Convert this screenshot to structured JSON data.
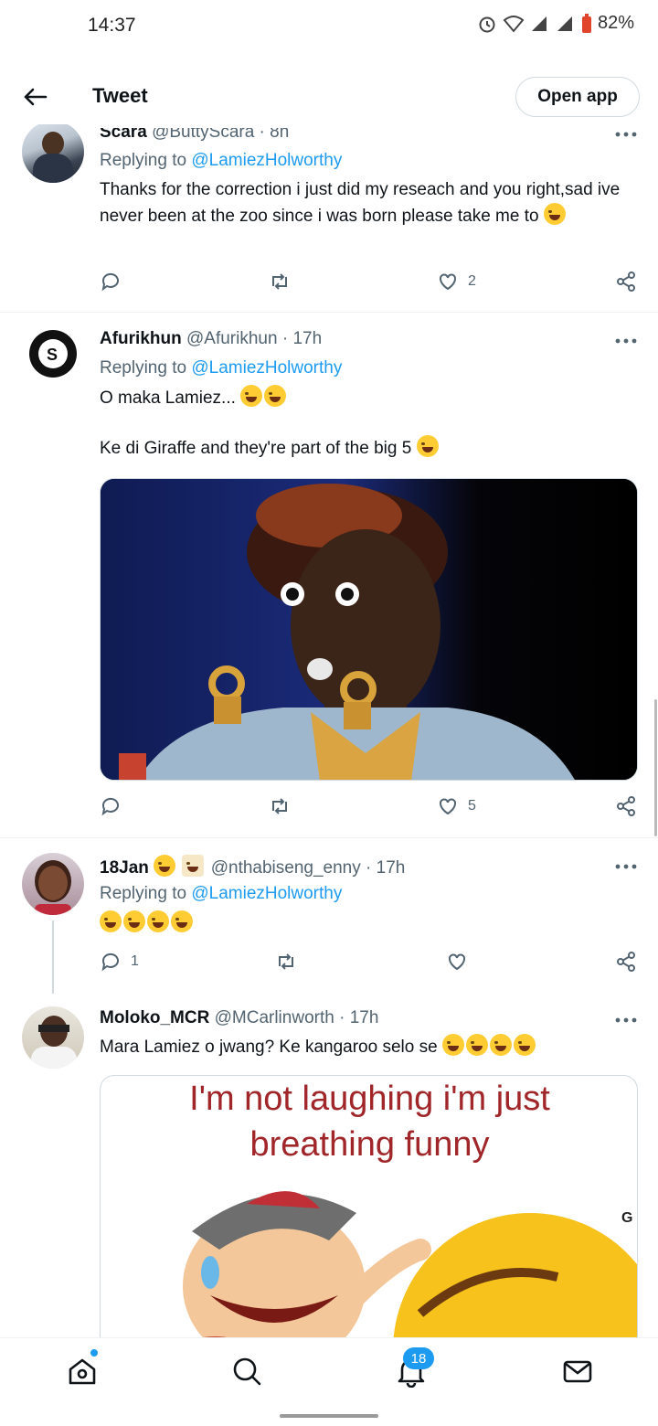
{
  "status_bar": {
    "time": "14:37",
    "battery": "82%"
  },
  "header": {
    "title": "Tweet",
    "open_app": "Open app"
  },
  "tweets": [
    {
      "name": "Scara",
      "handle": "@ButtyScara · 8h",
      "replying_prefix": "Replying to",
      "replying_to": "@LamiezHolworthy",
      "text": "Thanks for the correction i just did my reseach and you right,sad ive never been at the zoo since i was born please take me to",
      "likes": "2"
    },
    {
      "name": "Afurikhun",
      "handle": "@Afurikhun · 17h",
      "replying_prefix": "Replying to",
      "replying_to": "@LamiezHolworthy",
      "text_line1": "O maka Lamiez...",
      "text_line2": "Ke di Giraffe and they're part of the big 5",
      "likes": "5"
    },
    {
      "name": "18Jan",
      "handle": "@nthabiseng_enny · 17h",
      "replying_prefix": "Replying to",
      "replying_to": "@LamiezHolworthy",
      "replies": "1"
    },
    {
      "name": "Moloko_MCR",
      "handle": "@MCarlinworth · 17h",
      "text": "Mara Lamiez o jwang? Ke kangaroo selo se",
      "meme_line1": "I'm not laughing i'm just",
      "meme_line2": "breathing funny"
    }
  ],
  "bottom_nav": {
    "notifications_badge": "18"
  },
  "colors": {
    "accent": "#1d9bf0",
    "text": "#0f1419",
    "muted": "#536471"
  }
}
